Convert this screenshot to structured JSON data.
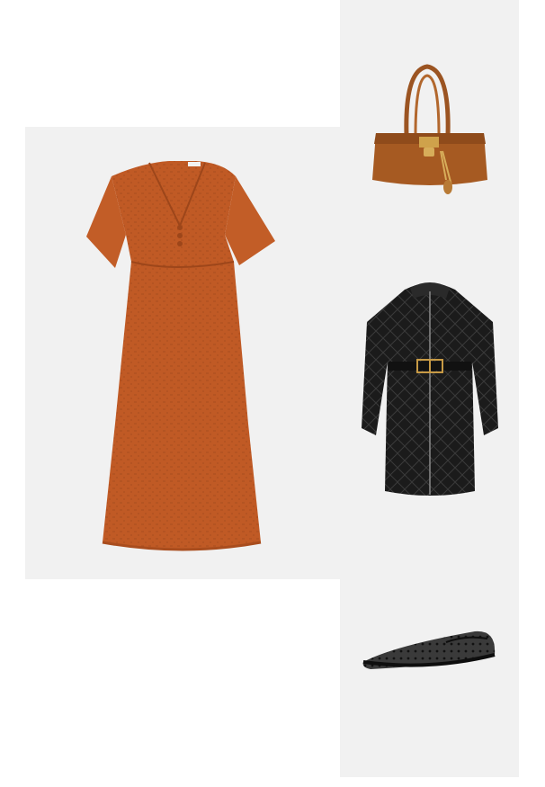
{
  "outfit": {
    "items": [
      {
        "name": "Dress",
        "color": "#c05a25"
      },
      {
        "name": "Handbag",
        "color": "#a65a22"
      },
      {
        "name": "Quilted coat",
        "color": "#1b1b1b"
      },
      {
        "name": "Mesh ballet flats",
        "color": "#1a1a1a"
      }
    ],
    "panel_bg": "#f1f1f1"
  }
}
